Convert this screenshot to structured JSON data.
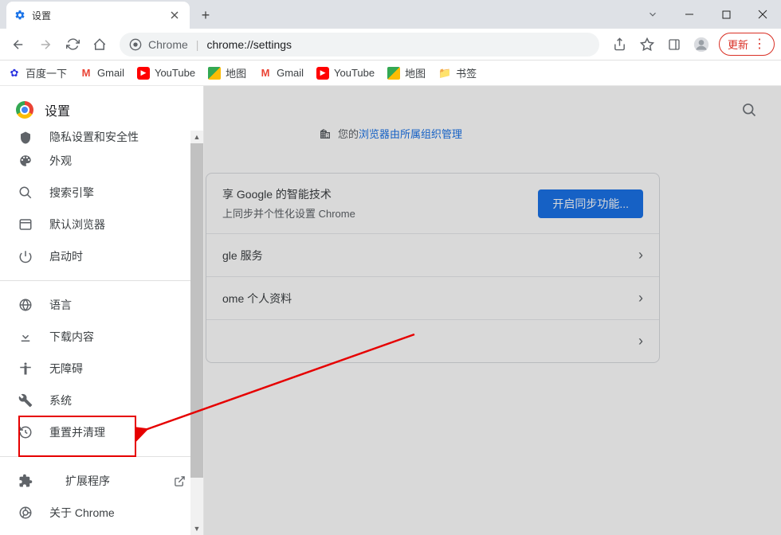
{
  "window": {
    "tab_title": "设置",
    "url_scheme": "Chrome",
    "url_path": "chrome://settings",
    "update_label": "更新"
  },
  "bookmarks": [
    {
      "label": "百度一下",
      "icon": "baidu"
    },
    {
      "label": "Gmail",
      "icon": "gmail"
    },
    {
      "label": "YouTube",
      "icon": "yt"
    },
    {
      "label": "地图",
      "icon": "maps"
    },
    {
      "label": "Gmail",
      "icon": "gmail"
    },
    {
      "label": "YouTube",
      "icon": "yt"
    },
    {
      "label": "地图",
      "icon": "maps"
    },
    {
      "label": "书签",
      "icon": "folder"
    }
  ],
  "sidebar": {
    "title": "设置",
    "item_cut": "隐私设置和安全性",
    "items_a": [
      {
        "icon": "palette",
        "label": "外观"
      },
      {
        "icon": "search",
        "label": "搜索引擎"
      },
      {
        "icon": "browser",
        "label": "默认浏览器"
      },
      {
        "icon": "power",
        "label": "启动时"
      }
    ],
    "items_b": [
      {
        "icon": "globe",
        "label": "语言"
      },
      {
        "icon": "download",
        "label": "下载内容"
      },
      {
        "icon": "accessibility",
        "label": "无障碍"
      },
      {
        "icon": "wrench",
        "label": "系统"
      },
      {
        "icon": "restore",
        "label": "重置并清理"
      }
    ],
    "items_c": [
      {
        "icon": "extension",
        "label": "扩展程序",
        "external": true
      },
      {
        "icon": "chrome",
        "label": "关于 Chrome"
      }
    ]
  },
  "main": {
    "managed_prefix": "您的",
    "managed_link": "浏览器由所属组织管理",
    "sync_title": "享 Google 的智能技术",
    "sync_sub": "上同步并个性化设置 Chrome",
    "sync_btn": "开启同步功能...",
    "row_google": "gle 服务",
    "row_profile": "ome 个人资料"
  }
}
